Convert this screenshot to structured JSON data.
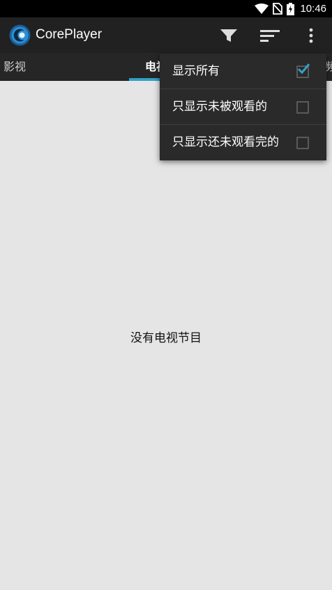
{
  "status_bar": {
    "time": "10:46",
    "icons": [
      "wifi-icon",
      "no-sim-icon",
      "battery-charging-icon"
    ]
  },
  "action_bar": {
    "app_name": "CorePlayer",
    "icons": [
      "coreplayer-logo-icon",
      "filter-icon",
      "sort-icon",
      "overflow-menu-icon"
    ]
  },
  "tabs": [
    {
      "label": "影视",
      "active": false
    },
    {
      "label": "电视",
      "active": true
    },
    {
      "label": "频",
      "active": false
    }
  ],
  "content": {
    "empty_message": "没有电视节目"
  },
  "filter_menu": {
    "items": [
      {
        "label": "显示所有",
        "checked": true
      },
      {
        "label": "只显示未被观看的",
        "checked": false
      },
      {
        "label": "只显示还未观看完的",
        "checked": false
      }
    ]
  },
  "colors": {
    "accent": "#33a0c8",
    "action_bar": "#212121",
    "tab_bar": "#262626",
    "menu_bg": "#2a2a2a",
    "background": "#e5e5e5"
  }
}
